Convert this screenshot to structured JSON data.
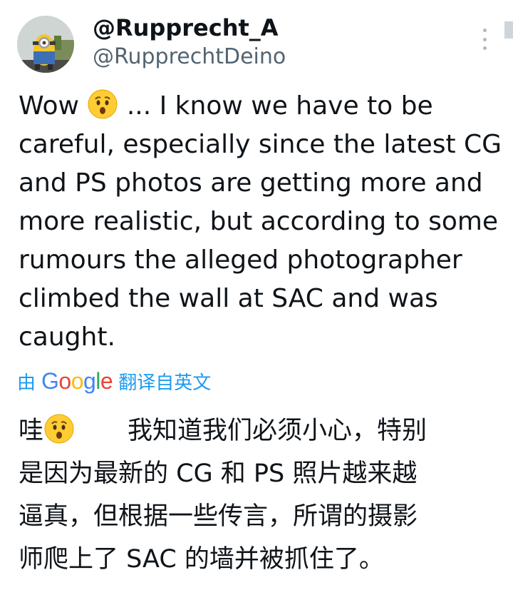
{
  "author": {
    "display_name": "@Rupprecht_A",
    "handle": "@RupprechtDeino"
  },
  "tweet": {
    "text_before_emoji": "Wow ",
    "emoji_name": "hushed-face-emoji",
    "text_after_emoji": " ... I know we have to be careful, especially since the latest CG and PS photos are getting more and more realistic, but according to some rumours the alleged photographer climbed the wall at SAC and was caught."
  },
  "translation": {
    "prefix": "由",
    "brand": "Google",
    "suffix": "翻译自英文",
    "line1_before_emoji": "哇",
    "line1_after_emoji": "我知道我们必须小心，特别",
    "line2": "是因为最新的 CG 和 PS 照片越来越",
    "line3": "逼真，但根据一些传言，所谓的摄影",
    "line4": "师爬上了 SAC 的墙并被抓住了。"
  },
  "colors": {
    "text": "#0f1419",
    "secondary": "#536471",
    "link": "#1d9bf0"
  }
}
